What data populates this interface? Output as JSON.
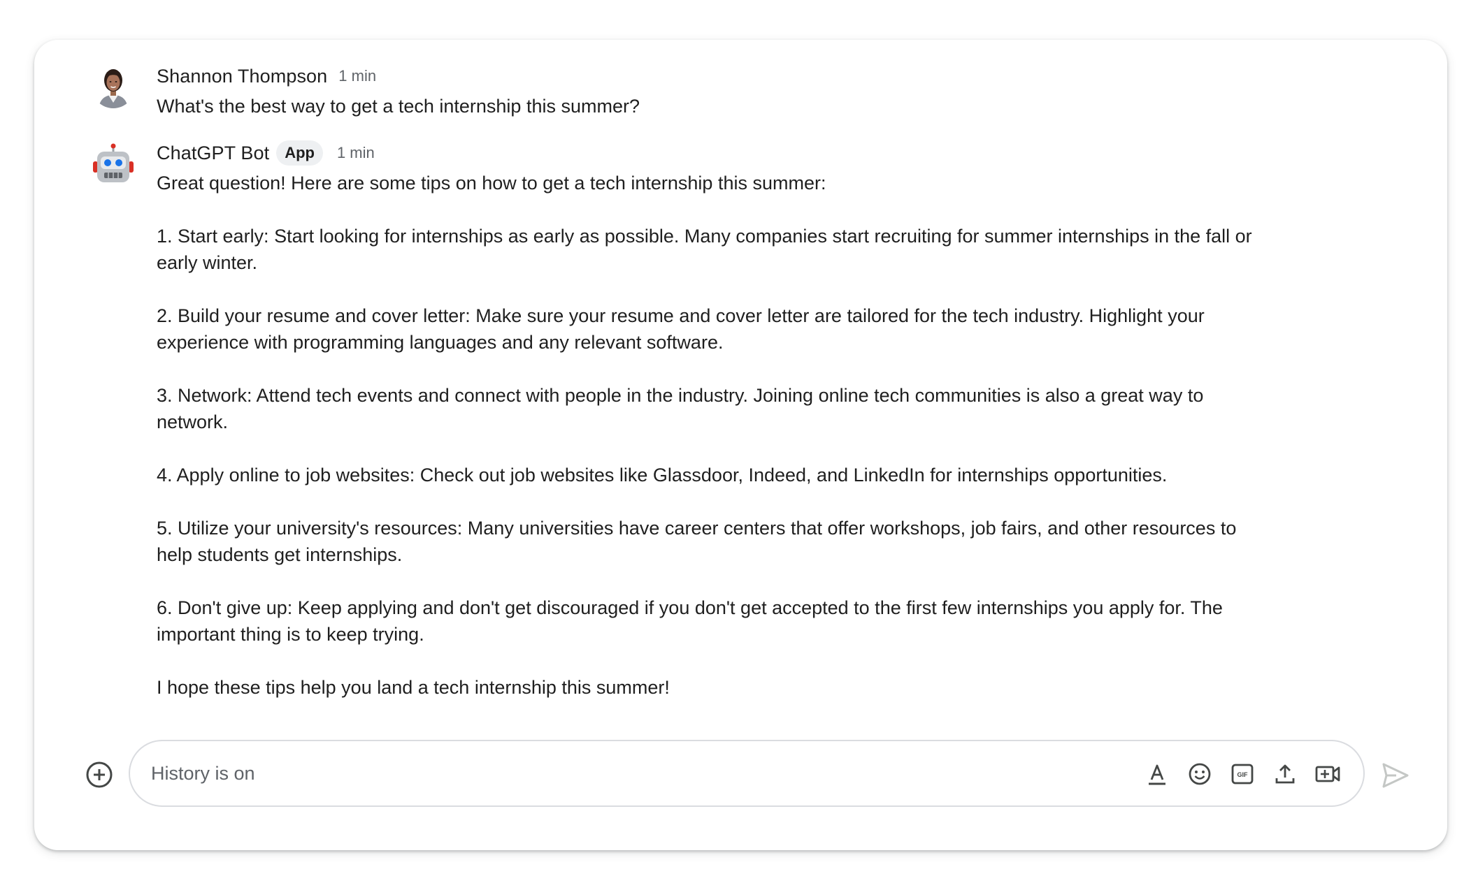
{
  "messages": [
    {
      "sender": "Shannon Thompson",
      "time": "1 min",
      "text": "What's the best way to get a tech internship this summer?"
    },
    {
      "sender": "ChatGPT Bot",
      "badge": "App",
      "time": "1 min",
      "paragraphs": [
        "Great question! Here are some tips on how to get a tech internship this summer:",
        "1. Start early: Start looking for internships as early as possible. Many companies start recruiting for summer internships in the fall or early winter.",
        "2. Build your resume and cover letter: Make sure your resume and cover letter are tailored for the tech industry. Highlight your experience with programming languages and any relevant software.",
        "3. Network: Attend tech events and connect with people in the industry. Joining online tech communities is also a great way to network.",
        "4. Apply online to job websites: Check out job websites like Glassdoor, Indeed, and LinkedIn for internships opportunities.",
        "5. Utilize your university's resources: Many universities have career centers that offer workshops, job fairs, and other resources to help students get internships.",
        "6. Don't give up: Keep applying and don't get discouraged if you don't get accepted to the first few internships you apply for. The important thing is to keep trying.",
        "I hope these tips help you land a tech internship this summer!"
      ]
    }
  ],
  "composer": {
    "placeholder": "History is on",
    "icons": [
      "add-circle-icon",
      "text-format-icon",
      "emoji-icon",
      "gif-icon",
      "upload-icon",
      "video-call-icon",
      "send-icon"
    ]
  },
  "colors": {
    "text": "#1f1f1f",
    "muted": "#5f6368",
    "border": "#dadce0",
    "badge_bg": "#eef0f2",
    "send_disabled": "#c4c7c5"
  }
}
